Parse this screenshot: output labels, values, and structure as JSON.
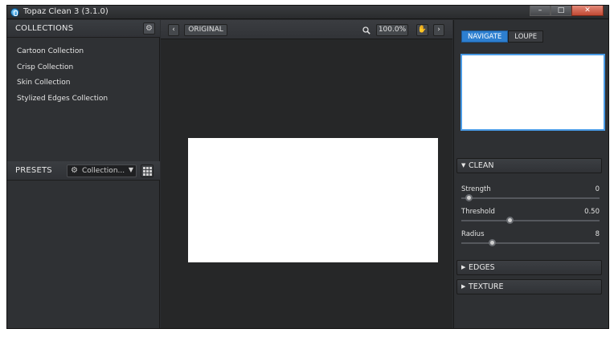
{
  "window": {
    "title": "Topaz Clean 3 (3.1.0)",
    "controls": {
      "minimize": "–",
      "maximize": "□",
      "close": "✕"
    }
  },
  "collections": {
    "title": "COLLECTIONS",
    "settings_icon": "gear-icon",
    "items": [
      {
        "label": "Cartoon Collection"
      },
      {
        "label": "Crisp Collection"
      },
      {
        "label": "Skin Collection"
      },
      {
        "label": "Stylized Edges Collection"
      }
    ]
  },
  "presets": {
    "title": "PRESETS",
    "dropdown_value": "Collection...",
    "grid_icon": "grid-icon"
  },
  "toolbar": {
    "prev_icon": "chevron-left-icon",
    "original_label": "ORIGINAL",
    "zoom_icon": "magnifier-icon",
    "zoom_value": "100.0%",
    "pan_icon": "hand-icon",
    "next_icon": "chevron-right-icon"
  },
  "navigator": {
    "tabs": [
      {
        "label": "NAVIGATE",
        "active": true
      },
      {
        "label": "LOUPE",
        "active": false
      }
    ]
  },
  "panels": {
    "clean": {
      "title": "CLEAN",
      "sliders": [
        {
          "label": "Strength",
          "value": "0",
          "fraction": 0.05
        },
        {
          "label": "Threshold",
          "value": "0.50",
          "fraction": 0.35
        },
        {
          "label": "Radius",
          "value": "8",
          "fraction": 0.22
        }
      ]
    },
    "edges": {
      "title": "EDGES"
    },
    "texture": {
      "title": "TEXTURE"
    }
  },
  "colors": {
    "accent": "#2d7fd0",
    "panel_bg": "#2e3033",
    "canvas_bg": "#262728"
  }
}
